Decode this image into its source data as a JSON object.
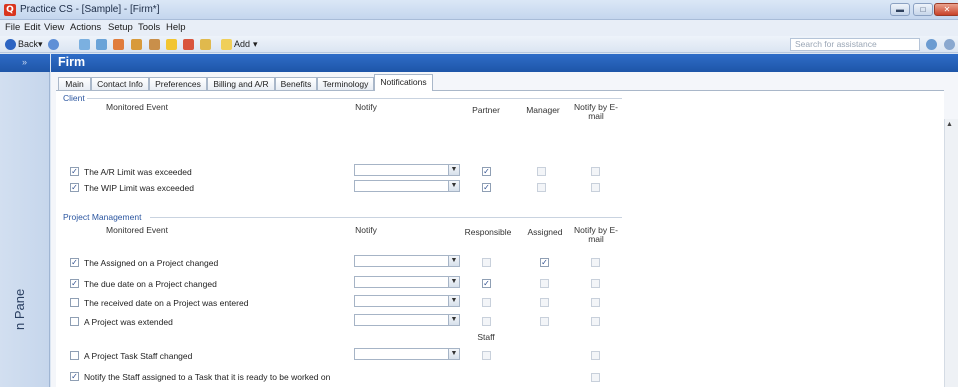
{
  "window": {
    "title": "Practice CS - [Sample] - [Firm*]",
    "app_icon": "Q"
  },
  "menu": [
    "File",
    "Edit",
    "View",
    "Actions",
    "Setup",
    "Tools",
    "Help"
  ],
  "toolbar": {
    "back_label": "Back",
    "add_label": "Add",
    "search_placeholder": "Search for assistance"
  },
  "navpane": {
    "label": "n Pane"
  },
  "page": {
    "title": "Firm"
  },
  "tabs": [
    "Main",
    "Contact Info",
    "Preferences",
    "Billing and A/R",
    "Benefits",
    "Terminology",
    "Notifications"
  ],
  "active_tab": "Notifications",
  "client": {
    "group_label": "Client",
    "headers": {
      "event": "Monitored Event",
      "notify": "Notify",
      "c1": "Partner",
      "c2": "Manager",
      "c3": "Notify by E-mail"
    },
    "rows": [
      {
        "checked": true,
        "label": "The A/R Limit was exceeded",
        "select": "",
        "c1": true,
        "c2": false,
        "c3": false
      },
      {
        "checked": true,
        "label": "The WIP Limit was exceeded",
        "select": "",
        "c1": true,
        "c2": false,
        "c3": false
      }
    ]
  },
  "project": {
    "group_label": "Project Management",
    "headers": {
      "event": "Monitored Event",
      "notify": "Notify",
      "c1": "Responsible",
      "c2": "Assigned",
      "c3": "Notify by E-mail"
    },
    "rows": [
      {
        "checked": true,
        "label": "The Assigned on a Project changed",
        "c1": false,
        "c2": true,
        "c3": false
      },
      {
        "checked": true,
        "label": "The due date on a Project changed",
        "c1": true,
        "c2": false,
        "c3": false
      },
      {
        "checked": false,
        "label": "The received date on a Project was entered",
        "c1": false,
        "c2": false,
        "c3": false
      },
      {
        "checked": false,
        "label": "A Project was extended",
        "c1": false,
        "c2": false,
        "c3": false
      }
    ],
    "staff_label": "Staff",
    "staff_rows": [
      {
        "checked": false,
        "label": "A Project Task Staff changed",
        "c1": false,
        "c3": false
      },
      {
        "checked": true,
        "label": "Notify the Staff assigned to a Task that it is ready to be worked on",
        "c3": false
      }
    ]
  }
}
